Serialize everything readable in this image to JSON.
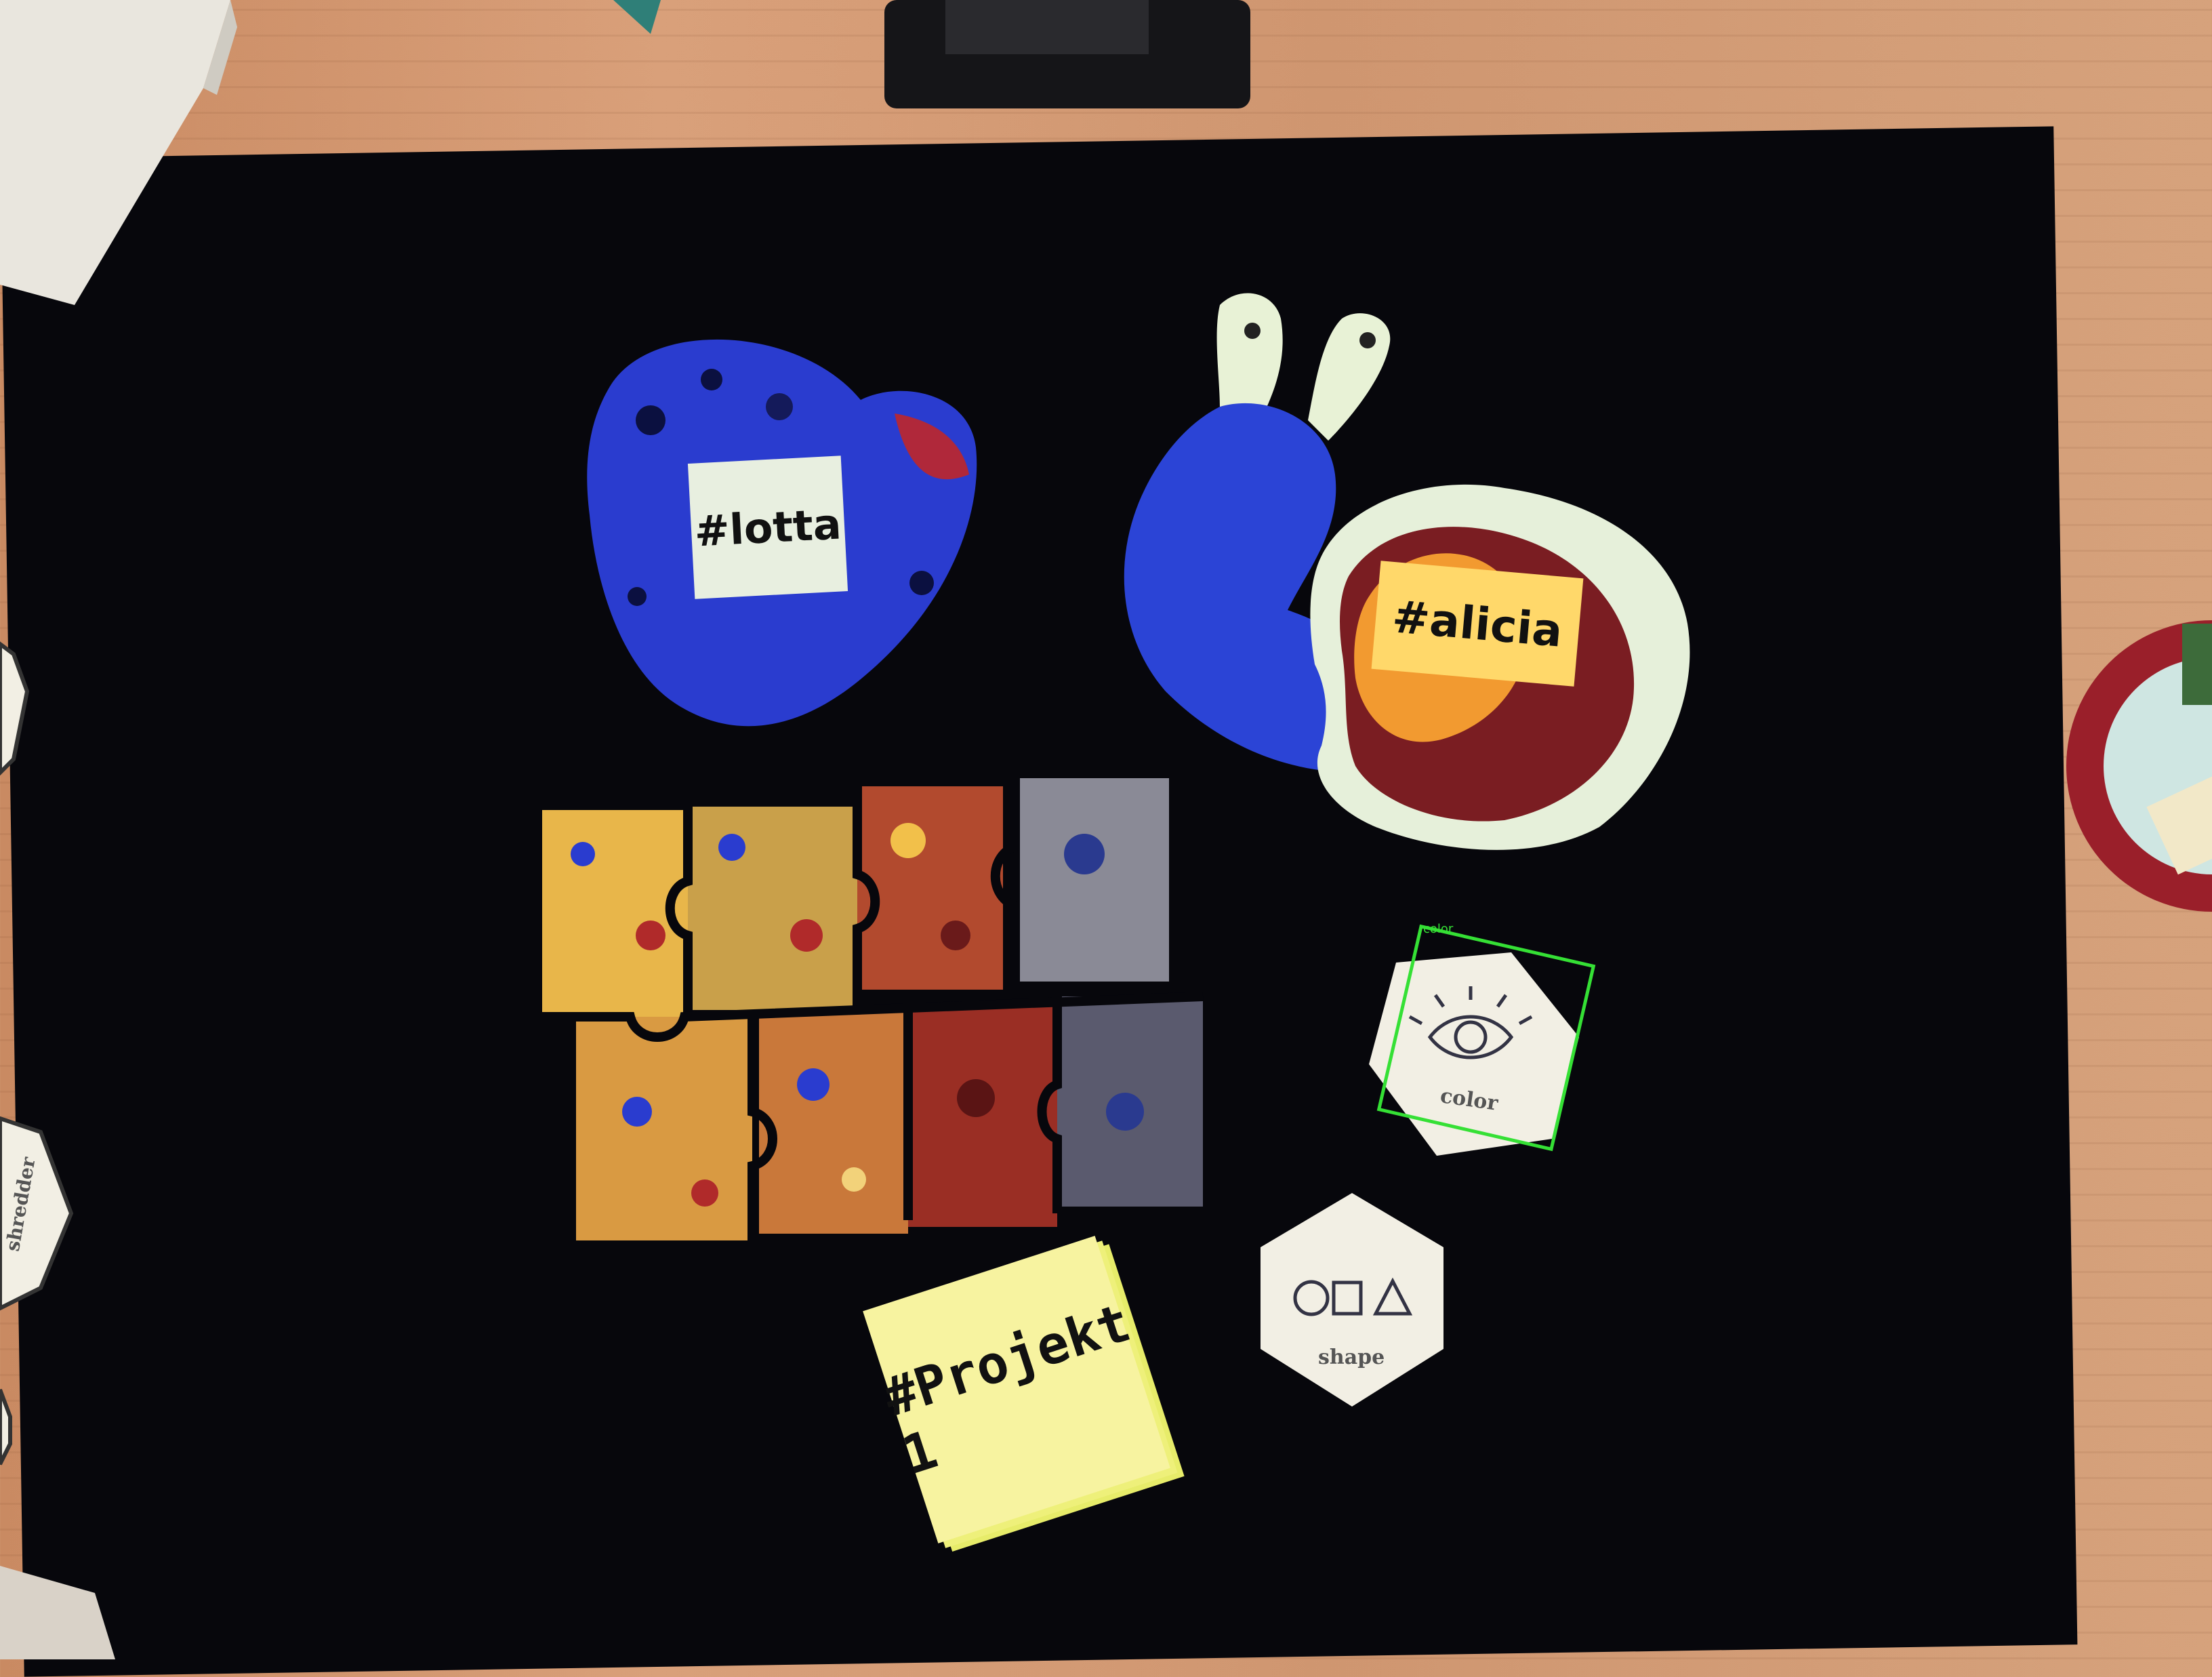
{
  "scene": {
    "tags": {
      "lotta": "#lotta",
      "alicia": "#alicia",
      "project": "#Projekt 1"
    },
    "tiles": {
      "color_label": "color",
      "shape_label": "shape",
      "shredder_label": "shredder"
    },
    "detection": {
      "label": "color",
      "color": "#35e035"
    },
    "colors": {
      "board": "#07070c",
      "wood": "#d6a27c",
      "blue_piece": "#2b3fd6",
      "sticky_note": "#f7f3a0"
    }
  }
}
